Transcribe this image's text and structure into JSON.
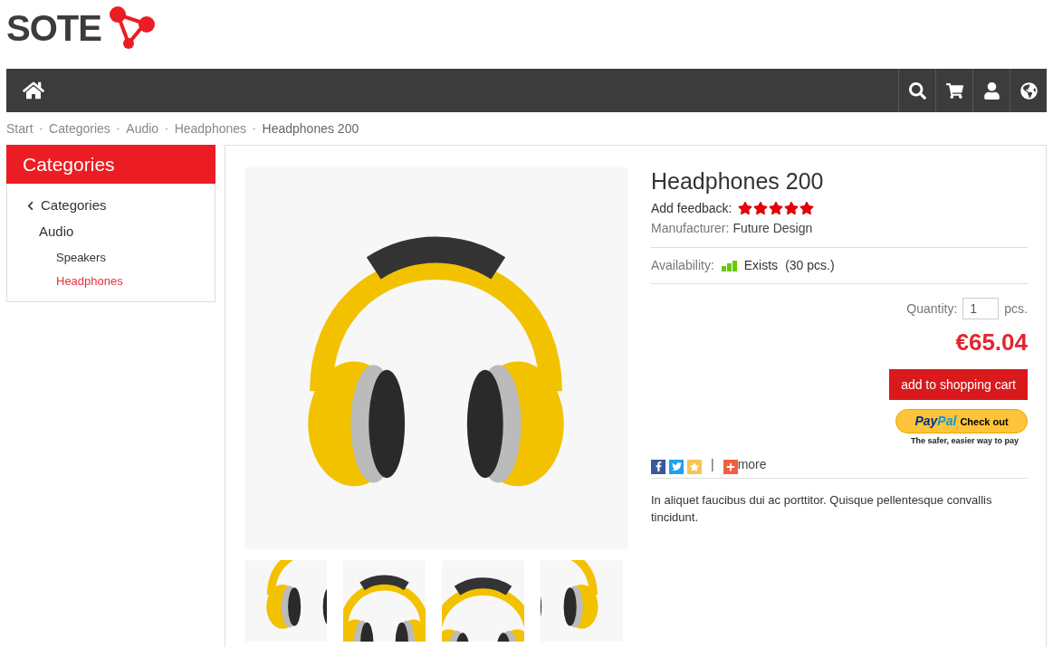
{
  "logo": {
    "text": "SOTE"
  },
  "breadcrumbs": [
    {
      "label": "Start"
    },
    {
      "separator": "•",
      "label": "Categories"
    },
    {
      "separator": "•",
      "label": "Audio"
    },
    {
      "separator": "•",
      "label": "Headphones"
    },
    {
      "separator": "•",
      "label": "Headphones 200"
    }
  ],
  "sidebar": {
    "title": "Categories",
    "back": {
      "label": "Categories"
    },
    "items": [
      {
        "label": "Audio",
        "selected": false,
        "children": [
          {
            "label": "Speakers",
            "selected": false
          },
          {
            "label": "Headphones",
            "selected": true
          }
        ]
      }
    ]
  },
  "product": {
    "title": "Headphones 200",
    "feedback_label": "Add feedback:",
    "stars": 5,
    "manufacturer_label": "Manufacturer:",
    "manufacturer": "Future Design",
    "availability_label": "Availability:",
    "availability": "Exists",
    "stock": "(30 pcs.)",
    "quantity_label": "Quantity:",
    "quantity": "1",
    "quantity_unit": "pcs.",
    "price": "€65.04",
    "add_button": "add to shopping cart",
    "paypal": {
      "brand_first": "Pay",
      "brand_second": "Pal",
      "action": "Check out",
      "tagline": "The safer, easier way to pay"
    },
    "share": {
      "separator": "|",
      "more": "more"
    },
    "description": "In aliquet faucibus dui ac porttitor. Quisque pellentesque convallis tincidunt."
  }
}
